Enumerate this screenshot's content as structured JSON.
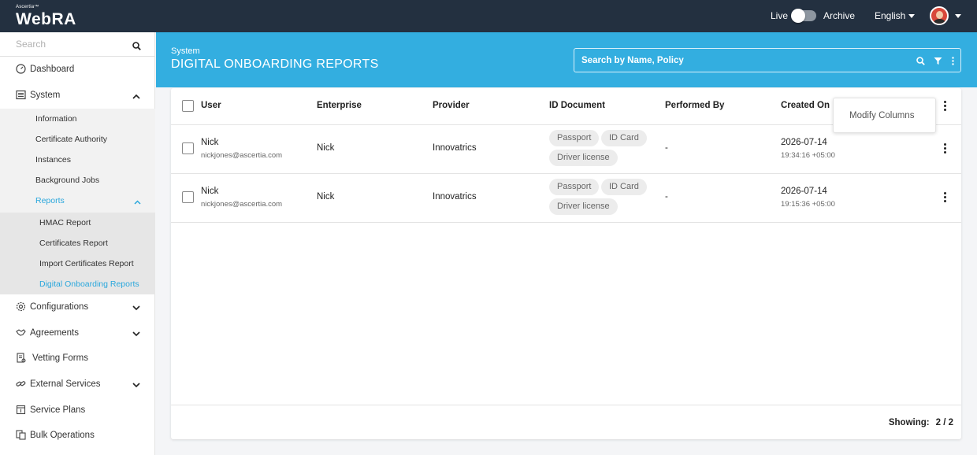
{
  "app": {
    "brand_small": "Ascertia™",
    "brand": "WebRA"
  },
  "topbar": {
    "live_label": "Live",
    "archive_label": "Archive",
    "language": "English"
  },
  "sidebar": {
    "search_placeholder": "Search",
    "items": [
      {
        "label": "Dashboard",
        "icon": "dashboard-icon"
      },
      {
        "label": "System",
        "icon": "system-icon",
        "expanded": true
      },
      {
        "label": "Configurations",
        "icon": "gear-icon"
      },
      {
        "label": "Agreements",
        "icon": "handshake-icon"
      },
      {
        "label": "Vetting Forms",
        "icon": "form-icon"
      },
      {
        "label": "External Services",
        "icon": "link-icon"
      },
      {
        "label": "Service Plans",
        "icon": "plan-icon"
      },
      {
        "label": "Bulk Operations",
        "icon": "bulk-icon"
      }
    ],
    "system_children": [
      "Information",
      "Certificate Authority",
      "Instances",
      "Background Jobs",
      "Reports"
    ],
    "reports_children": [
      "HMAC Report",
      "Certificates Report",
      "Import Certificates Report",
      "Digital Onboarding Reports"
    ]
  },
  "header": {
    "breadcrumb": "System",
    "title": "DIGITAL ONBOARDING REPORTS",
    "search_placeholder": "Search by Name, Policy"
  },
  "table": {
    "columns": [
      "User",
      "Enterprise",
      "Provider",
      "ID Document",
      "Performed By",
      "Created On"
    ],
    "menu_option": "Modify Columns",
    "rows": [
      {
        "user": "Nick",
        "email": "nickjones@ascertia.com",
        "enterprise": "Nick",
        "provider": "Innovatrics",
        "docs": [
          "Passport",
          "ID Card",
          "Driver license"
        ],
        "performed_by": "-",
        "date": "2026-07-14",
        "time": "19:34:16 +05:00"
      },
      {
        "user": "Nick",
        "email": "nickjones@ascertia.com",
        "enterprise": "Nick",
        "provider": "Innovatrics",
        "docs": [
          "Passport",
          "ID Card",
          "Driver license"
        ],
        "performed_by": "-",
        "date": "2026-07-14",
        "time": "19:15:36 +05:00"
      }
    ],
    "footer": {
      "showing_label": "Showing:",
      "showing_value": "2 / 2"
    }
  },
  "colors": {
    "topbar": "#233040",
    "accent": "#33aee0",
    "active_link": "#2aa7dc"
  }
}
